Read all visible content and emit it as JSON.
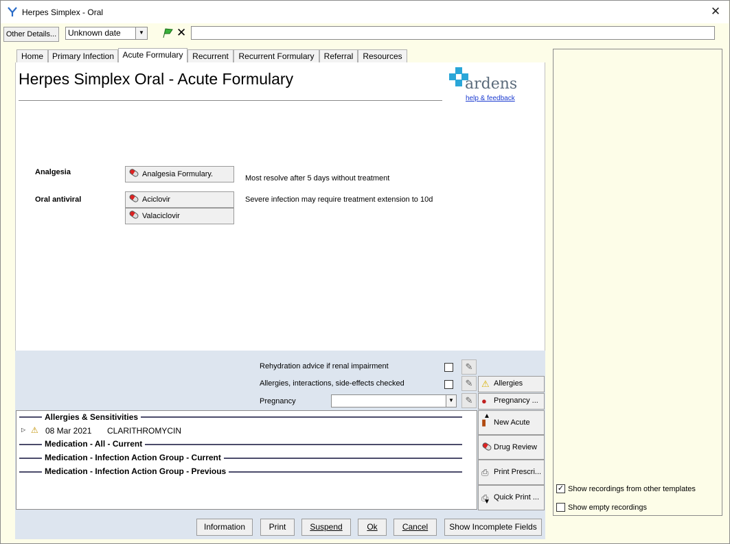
{
  "window": {
    "title": "Herpes Simplex - Oral",
    "close_glyph": "✕"
  },
  "toolbar": {
    "other_details": "Other Details...",
    "date_value": "Unknown date",
    "flag_icon": "green-flag-icon",
    "clear_glyph": "✕"
  },
  "tabs": [
    {
      "label": "Home"
    },
    {
      "label": "Primary Infection"
    },
    {
      "label": "Acute Formulary",
      "active": true
    },
    {
      "label": "Recurrent"
    },
    {
      "label": "Recurrent Formulary"
    },
    {
      "label": "Referral"
    },
    {
      "label": "Resources"
    }
  ],
  "page": {
    "title": "Herpes Simplex Oral - Acute Formulary",
    "brand": "ardens",
    "help_link": "help & feedback"
  },
  "sections": {
    "analgesia": {
      "label": "Analgesia",
      "button": "Analgesia Formulary.",
      "note": "Most resolve after 5 days without treatment"
    },
    "oral_antiviral": {
      "label": "Oral antiviral",
      "buttons": [
        "Aciclovir",
        "Valaciclovir"
      ],
      "note": "Severe infection may require treatment extension to 10d"
    }
  },
  "checks": {
    "rehydration": {
      "label": "Rehydration advice if renal impairment",
      "checked": false
    },
    "allergies": {
      "label": "Allergies, interactions, side-effects checked",
      "checked": false
    },
    "pregnancy": {
      "label": "Pregnancy",
      "value": ""
    }
  },
  "side_buttons": {
    "allergies": "Allergies",
    "pregnancy": "Pregnancy ...",
    "new_acute": "New Acute",
    "drug_review": "Drug Review",
    "print_prescri": "Print Prescri...",
    "quick_print": "Quick Print ..."
  },
  "list": {
    "allergies_header": "Allergies & Sensitivities",
    "allergy_entry": {
      "date": "08 Mar 2021",
      "drug": "CLARITHROMYCIN"
    },
    "med_all": "Medication - All - Current",
    "med_iag_current": "Medication - Infection Action Group - Current",
    "med_iag_previous": "Medication - Infection Action Group - Previous"
  },
  "right_panel": {
    "show_other": {
      "label": "Show recordings from other templates",
      "checked": true
    },
    "show_empty": {
      "label": "Show empty recordings",
      "checked": false
    }
  },
  "bottom": {
    "information": "Information",
    "print": "Print",
    "suspend": "Suspend",
    "ok": "Ok",
    "cancel": "Cancel",
    "show_incomplete": "Show Incomplete Fields"
  },
  "colors": {
    "accent_blue": "#2aa6d8",
    "brand_gray": "#5a6a7a",
    "panel_yellow": "#fdfde8",
    "lower_blue": "#dde5ef"
  }
}
